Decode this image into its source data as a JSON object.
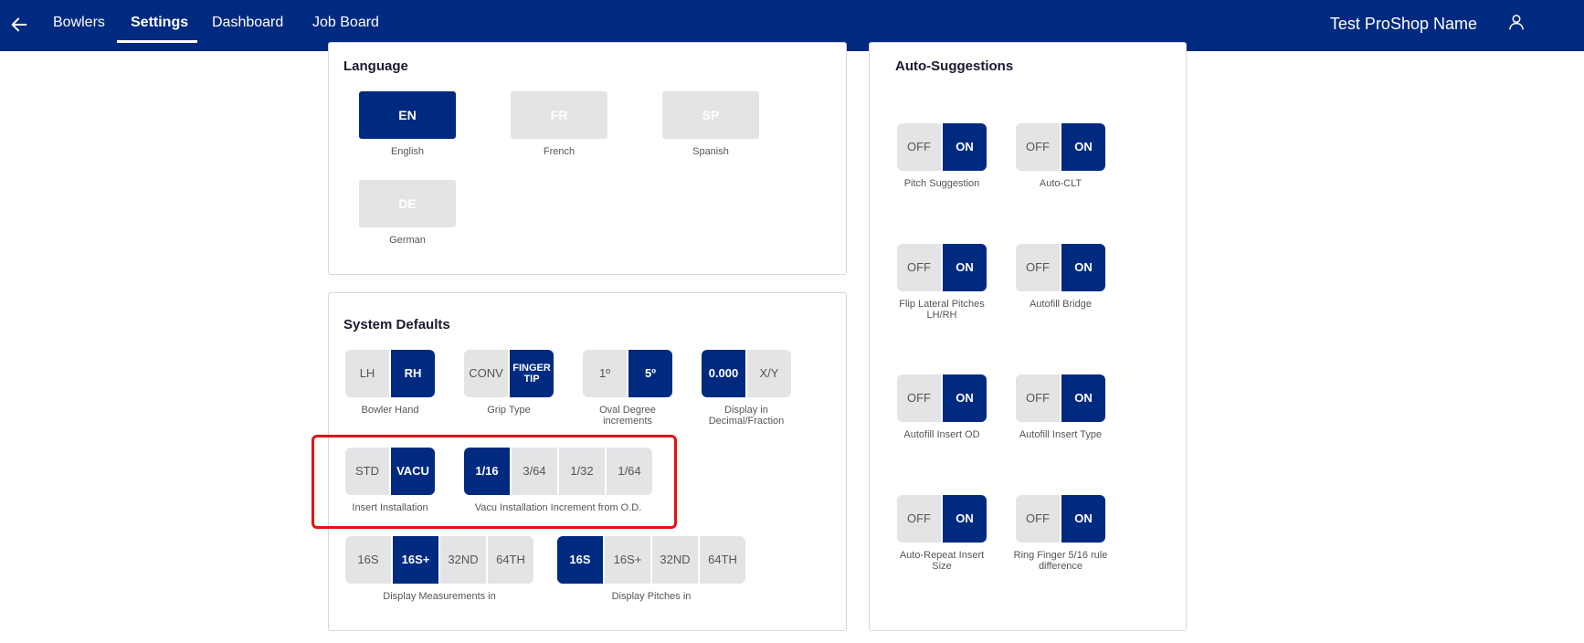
{
  "nav": {
    "items": [
      "Bowlers",
      "Settings",
      "Dashboard",
      "Job Board"
    ],
    "shop_name": "Test ProShop Name"
  },
  "language": {
    "title": "Language",
    "options": [
      {
        "code": "EN",
        "label": "English",
        "active": true
      },
      {
        "code": "FR",
        "label": "French",
        "active": false
      },
      {
        "code": "SP",
        "label": "Spanish",
        "active": false
      },
      {
        "code": "DE",
        "label": "German",
        "active": false
      }
    ]
  },
  "system_defaults": {
    "title": "System Defaults",
    "bowler_hand": {
      "label": "Bowler Hand",
      "options": [
        "LH",
        "RH"
      ],
      "selected": "RH"
    },
    "grip_type": {
      "label": "Grip Type",
      "options": [
        "CONV",
        "FINGER TIP"
      ],
      "selected": "FINGER TIP"
    },
    "oval_degree": {
      "label": "Oval Degree increments",
      "options": [
        "1º",
        "5º"
      ],
      "selected": "5º"
    },
    "display_decimal": {
      "label": "Display in Decimal/Fraction",
      "options": [
        "0.000",
        "X/Y"
      ],
      "selected": "0.000"
    },
    "insert_installation": {
      "label": "Insert Installation",
      "options": [
        "STD",
        "VACU"
      ],
      "selected": "VACU"
    },
    "vacu_increment": {
      "label": "Vacu Installation Increment from O.D.",
      "options": [
        "1/16",
        "3/64",
        "1/32",
        "1/64"
      ],
      "selected": "1/16"
    },
    "display_measurements": {
      "label": "Display Measurements in",
      "options": [
        "16S",
        "16S+",
        "32ND",
        "64TH"
      ],
      "selected": "16S+"
    },
    "display_pitches": {
      "label": "Display Pitches in",
      "options": [
        "16S",
        "16S+",
        "32ND",
        "64TH"
      ],
      "selected": "16S"
    }
  },
  "auto_suggestions": {
    "title": "Auto-Suggestions",
    "toggles": [
      {
        "label": "Pitch Suggestion",
        "off": "OFF",
        "on": "ON",
        "state": "ON"
      },
      {
        "label": "Auto-CLT",
        "off": "OFF",
        "on": "ON",
        "state": "ON"
      },
      {
        "label": "Flip Lateral Pitches LH/RH",
        "off": "OFF",
        "on": "ON",
        "state": "ON"
      },
      {
        "label": "Autofill Bridge",
        "off": "OFF",
        "on": "ON",
        "state": "ON"
      },
      {
        "label": "Autofill Insert OD",
        "off": "OFF",
        "on": "ON",
        "state": "ON"
      },
      {
        "label": "Autofill Insert Type",
        "off": "OFF",
        "on": "ON",
        "state": "ON"
      },
      {
        "label": "Auto-Repeat Insert Size",
        "off": "OFF",
        "on": "ON",
        "state": "ON"
      },
      {
        "label": "Ring Finger 5/16 rule difference",
        "off": "OFF",
        "on": "ON",
        "state": "ON"
      }
    ]
  },
  "colors": {
    "primary": "#002a7f",
    "inactive": "#e3e4e6",
    "highlight": "#e01414"
  }
}
